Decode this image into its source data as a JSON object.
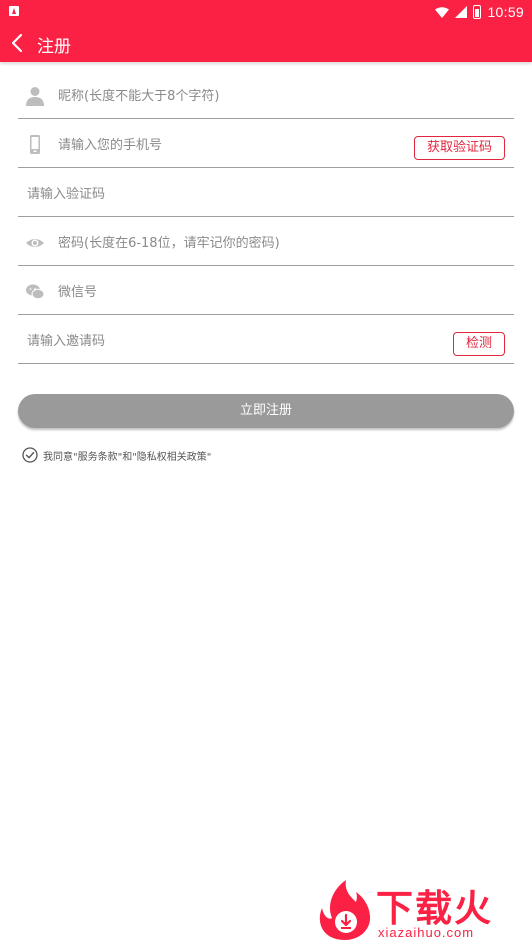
{
  "status_bar": {
    "time": "10:59",
    "icons": [
      "notification-icon",
      "wifi-icon",
      "signal-icon",
      "battery-icon"
    ]
  },
  "app_bar": {
    "title": "注册",
    "back_icon": "back-arrow-icon"
  },
  "form": {
    "nickname": {
      "placeholder": "昵称(长度不能大于8个字符)",
      "icon": "person-icon"
    },
    "phone": {
      "placeholder": "请输入您的手机号",
      "icon": "phone-icon",
      "button_label": "获取验证码"
    },
    "verify_code": {
      "placeholder": "请输入验证码"
    },
    "password": {
      "placeholder": "密码(长度在6-18位，请牢记你的密码)",
      "icon": "eye-icon"
    },
    "wechat": {
      "placeholder": "微信号",
      "icon": "wechat-icon"
    },
    "invite": {
      "placeholder": "请输入邀请码",
      "button_label": "检测"
    }
  },
  "register_button": "立即注册",
  "agreement": {
    "text": "我同意\"服务条款\"和\"隐私权相关政策\"",
    "checked": true
  },
  "watermark": {
    "title": "下载火",
    "subtitle": "xiazaihuo.com"
  },
  "colors": {
    "primary": "#fa2145",
    "button_gray": "#9a9a9a",
    "accent_border": "#e3263f"
  }
}
